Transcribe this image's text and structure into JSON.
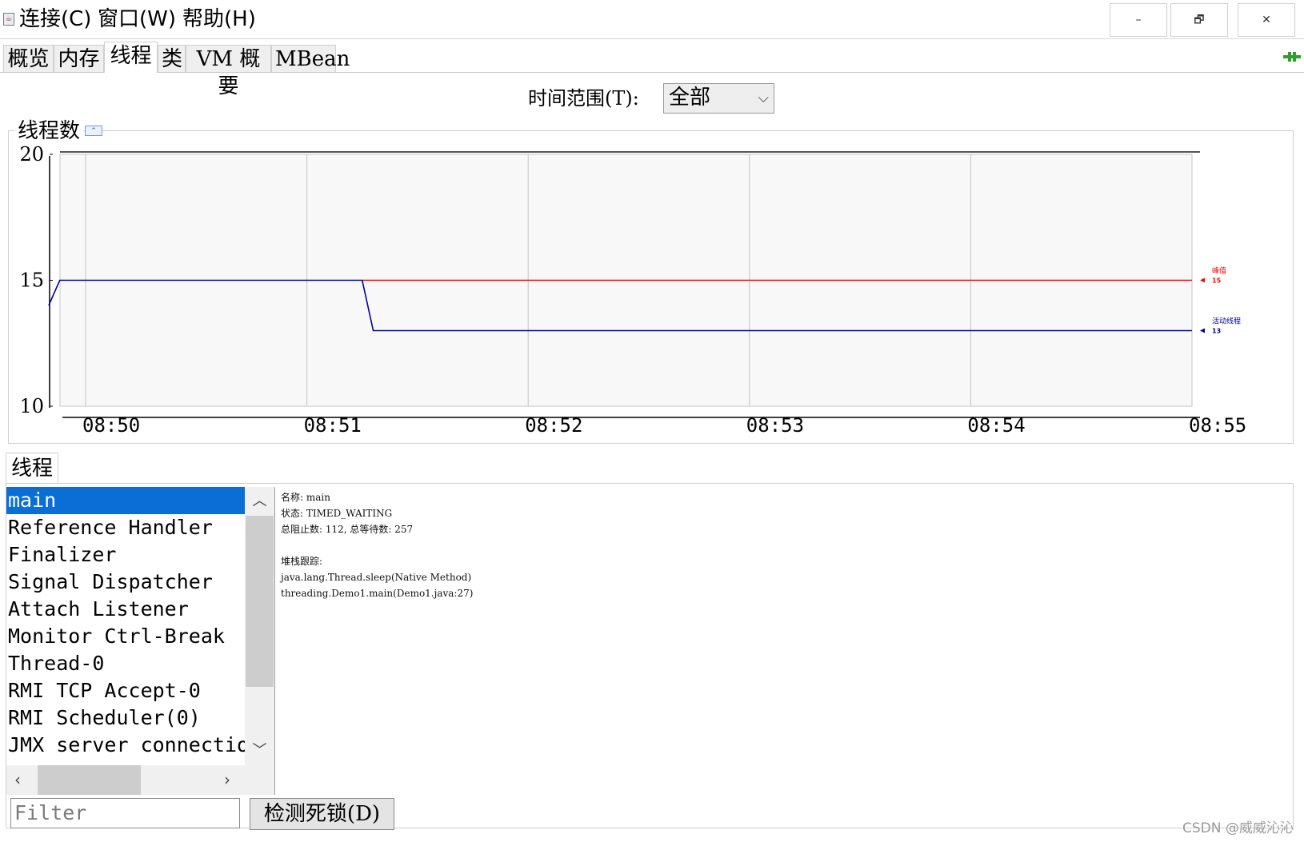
{
  "menu": {
    "items": [
      "连接(C)",
      "窗口(W)",
      "帮助(H)"
    ]
  },
  "window_controls": {
    "minimize": "–",
    "restore": "🗗",
    "close": "✕"
  },
  "tabs": [
    "概览",
    "内存",
    "线程",
    "类",
    "VM 概要",
    "MBean"
  ],
  "active_tab": "线程",
  "time_range": {
    "label": "时间范围(T):",
    "value": "全部"
  },
  "panel": {
    "title": "线程数"
  },
  "chart_data": {
    "type": "line",
    "x_ticks": [
      "08:50",
      "08:51",
      "08:52",
      "08:53",
      "08:54",
      "08:55"
    ],
    "y_ticks": [
      20,
      15,
      10
    ],
    "ylim": [
      10,
      20
    ],
    "grid": true,
    "series": [
      {
        "name": "峰值",
        "color": "#ff0000",
        "end_value_label": "15",
        "points": [
          [
            "08:51:15",
            15
          ],
          [
            "08:55",
            15
          ]
        ]
      },
      {
        "name": "活动线程",
        "color": "#0000a0",
        "end_value_label": "13",
        "points": [
          [
            "08:49:50",
            14
          ],
          [
            "08:49:53",
            15
          ],
          [
            "08:51:15",
            15
          ],
          [
            "08:51:18",
            13
          ],
          [
            "08:55",
            13
          ]
        ]
      }
    ]
  },
  "threads": {
    "tab_label": "线程",
    "list": [
      "main",
      "Reference Handler",
      "Finalizer",
      "Signal Dispatcher",
      "Attach Listener",
      "Monitor Ctrl-Break",
      "Thread-0",
      "RMI TCP Accept-0",
      "RMI Scheduler(0)",
      "JMX server connection"
    ],
    "selected": "main",
    "detail": [
      "名称: main",
      "状态: TIMED_WAITING",
      "总阻止数: 112, 总等待数: 257",
      "",
      "堆栈跟踪:",
      "java.lang.Thread.sleep(Native Method)",
      "threading.Demo1.main(Demo1.java:27)"
    ],
    "filter_placeholder": "Filter",
    "detect_button": "检测死锁(D)"
  },
  "watermark": "CSDN @威威沁沁"
}
